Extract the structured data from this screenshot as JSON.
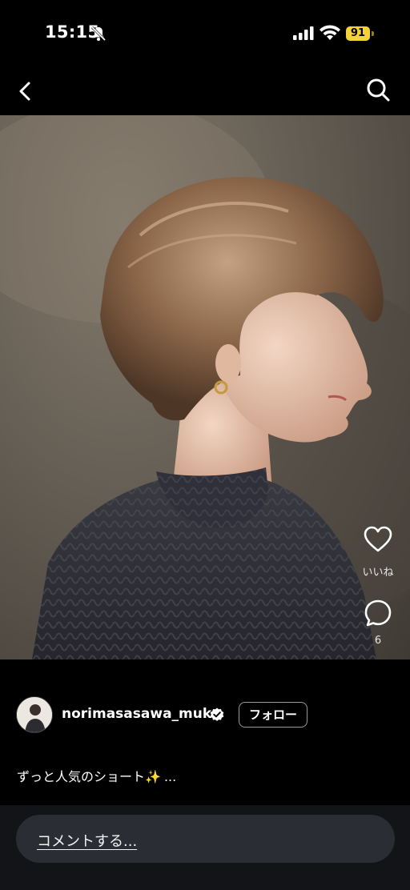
{
  "status_bar": {
    "time": "15:15",
    "battery": "91",
    "battery_color": "#f4d33a"
  },
  "nav": {
    "back_icon": "chevron-left-icon",
    "search_icon": "search-icon"
  },
  "post": {
    "likes_label": "いいね",
    "comment_count": "6",
    "username": "norimasasawa_muku",
    "follow_label": "フォロー",
    "caption": "ずっと人気のショート✨",
    "caption_more": "..."
  },
  "comment_bar": {
    "placeholder": "コメントする..."
  },
  "colors": {
    "background": "#000000",
    "comment_bar_bg": "#121418",
    "input_bg": "#2a2e34"
  }
}
